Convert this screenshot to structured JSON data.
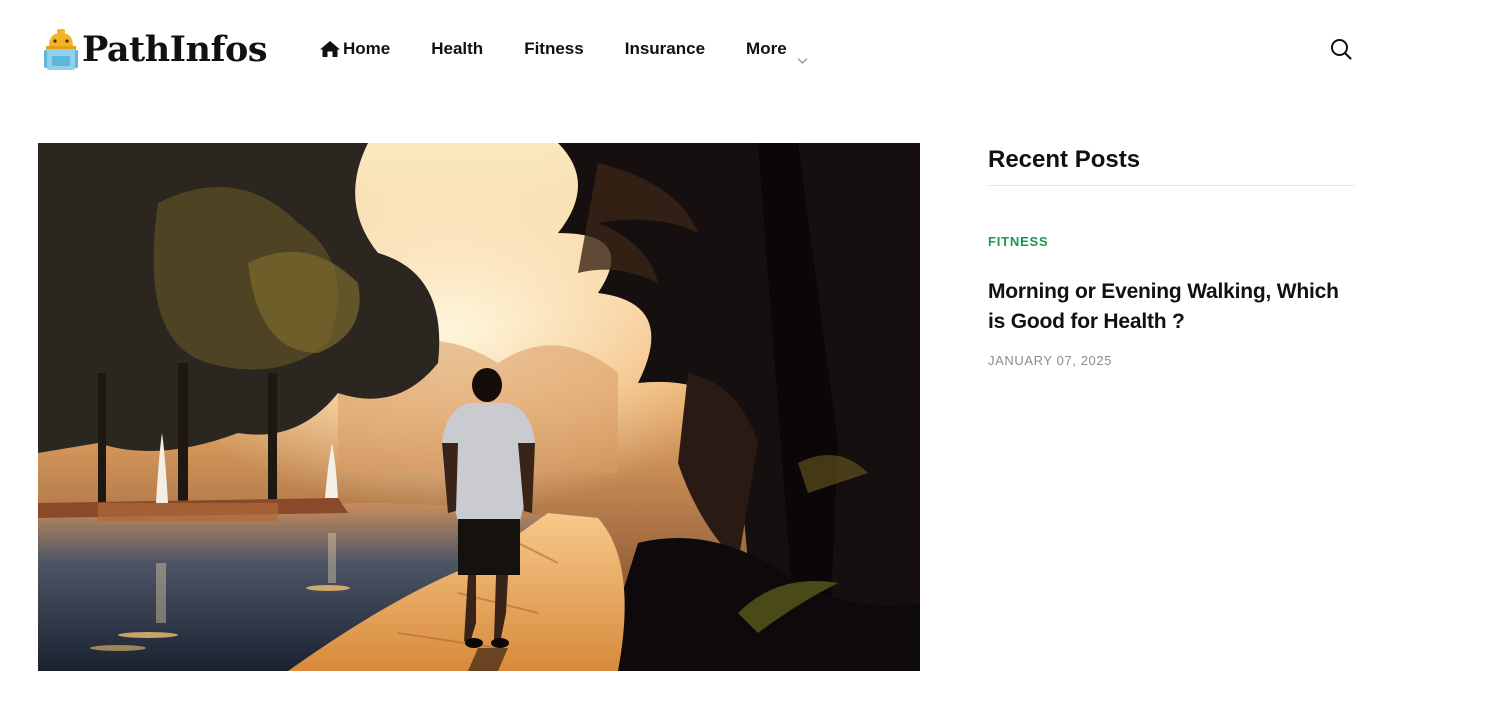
{
  "site": {
    "name": "PathInfos"
  },
  "nav": {
    "items": [
      {
        "label": "Home",
        "icon": "home-icon"
      },
      {
        "label": "Health"
      },
      {
        "label": "Fitness"
      },
      {
        "label": "Insurance"
      },
      {
        "label": "More",
        "icon": "chevron-down-icon"
      }
    ]
  },
  "search": {
    "icon": "search-icon"
  },
  "sidebar": {
    "title": "Recent Posts",
    "posts": [
      {
        "category": "FITNESS",
        "title": "Morning or Evening Walking, Which is Good for Health ?",
        "date": "JANUARY 07, 2025"
      }
    ]
  },
  "colors": {
    "category_accent": "#159a4e",
    "date_gray": "#8b8b8b",
    "text": "#111111"
  }
}
